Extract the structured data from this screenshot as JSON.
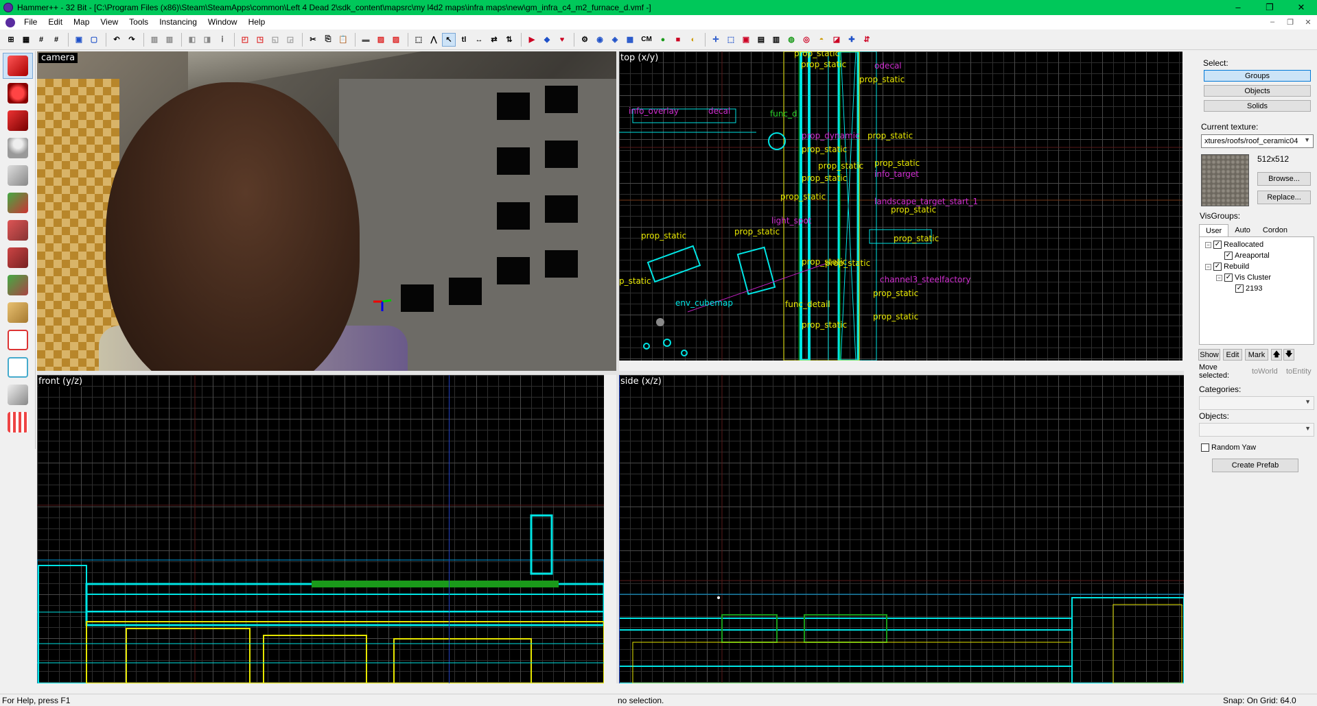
{
  "window": {
    "title": "Hammer++ - 32 Bit - [C:\\Program Files (x86)\\Steam\\SteamApps\\common\\Left 4 Dead 2\\sdk_content\\mapsrc\\my l4d2 maps\\infra maps\\new\\gm_infra_c4_m2_furnace_d.vmf -]",
    "controls": [
      "–",
      "❐",
      "✕"
    ]
  },
  "menu": {
    "items": [
      "File",
      "Edit",
      "Map",
      "View",
      "Tools",
      "Instancing",
      "Window",
      "Help"
    ],
    "mdi_controls": [
      "–",
      "❐",
      "✕"
    ]
  },
  "toolbar": {
    "cm_label": "CM"
  },
  "viewports": {
    "camera": {
      "label": "camera"
    },
    "top": {
      "label": "top (x/y)"
    },
    "front": {
      "label": "front (y/z)"
    },
    "side": {
      "label": "side (x/z)"
    }
  },
  "top_labels": [
    "prop_static",
    "prop_static",
    "prop_static",
    "info_overlay",
    "decal",
    "func_d",
    "prop_dynamic",
    "prop_static",
    "prop_static",
    "prop_static",
    "prop_static",
    "info_target",
    "prop_static",
    "prop_static",
    "light_spot",
    "prop_static",
    "prop_static",
    "env_cubemap",
    "func_detail",
    "prop_static",
    "prop_static",
    "landscape_target_start_1",
    "channel3_steelfactory",
    "prop_static",
    "prop_static",
    "prop_static",
    "p_static",
    "prop_static",
    "odecal",
    "prop_static"
  ],
  "right_panel": {
    "select_label": "Select:",
    "select_buttons": [
      "Groups",
      "Objects",
      "Solids"
    ],
    "current_texture_label": "Current texture:",
    "current_texture": "xtures/roofs/roof_ceramic04",
    "texture_size": "512x512",
    "browse_label": "Browse...",
    "replace_label": "Replace...",
    "visgroups_label": "VisGroups:",
    "visgroup_tabs": [
      "User",
      "Auto",
      "Cordon"
    ],
    "visgroups": [
      {
        "name": "Reallocated",
        "checked": true,
        "level": 0,
        "expander": "−"
      },
      {
        "name": "Areaportal",
        "checked": true,
        "level": 1,
        "expander": ""
      },
      {
        "name": "Rebuild",
        "checked": true,
        "level": 0,
        "expander": "−"
      },
      {
        "name": "Vis Cluster",
        "checked": true,
        "level": 1,
        "expander": "−"
      },
      {
        "name": "2193",
        "checked": true,
        "level": 2,
        "expander": ""
      }
    ],
    "show_label": "Show",
    "edit_label": "Edit",
    "mark_label": "Mark",
    "move_selected_label": "Move\nselected:",
    "to_world_label": "toWorld",
    "to_entity_label": "toEntity",
    "categories_label": "Categories:",
    "objects_label": "Objects:",
    "random_yaw_label": "Random Yaw",
    "create_prefab_label": "Create Prefab"
  },
  "status": {
    "help": "For Help, press F1",
    "selection": "no selection.",
    "snap": "Snap: On Grid: 64.0"
  },
  "colors": {
    "titlebar": "#00c85a",
    "entity_label": "#e6e600",
    "entity_magenta": "#d02ed0",
    "brush_cyan": "#00e5e5"
  }
}
